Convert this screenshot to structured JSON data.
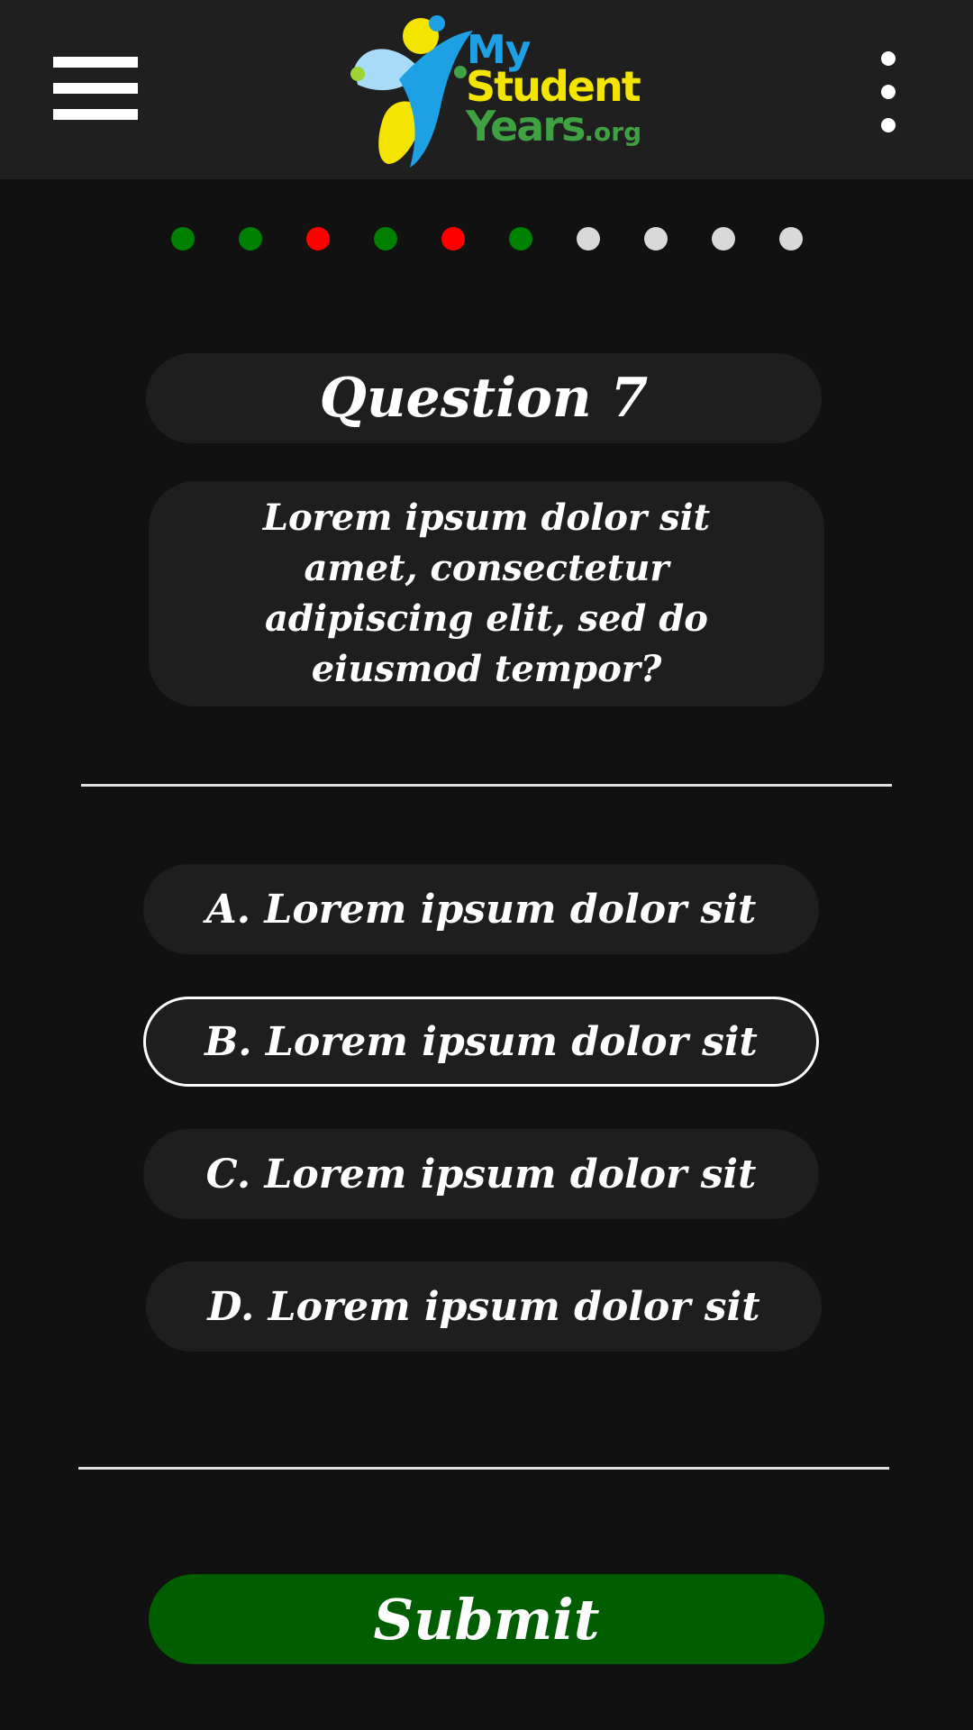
{
  "header": {
    "logo": {
      "line1": "My",
      "line2": "Student",
      "line3_main": "Years",
      "line3_suffix": ".org",
      "colors": {
        "blue": "#1da1e4",
        "yellow": "#f4e500",
        "green": "#3fa142",
        "light_blue": "#a8dbf7"
      }
    },
    "menu_icon": "hamburger-menu-icon",
    "more_icon": "vertical-dots-icon"
  },
  "progress": {
    "states": [
      "correct",
      "correct",
      "wrong",
      "correct",
      "wrong",
      "correct",
      "pending",
      "pending",
      "pending",
      "pending"
    ],
    "colors": {
      "correct": "#008000",
      "wrong": "#ff0000",
      "pending": "#d9d9d9"
    }
  },
  "question": {
    "title": "Question 7",
    "text": "Lorem ipsum dolor sit amet, consectetur adipiscing elit, sed do eiusmod tempor?"
  },
  "options": [
    {
      "label": "A. Lorem ipsum dolor sit",
      "selected": false
    },
    {
      "label": "B. Lorem ipsum dolor sit",
      "selected": true
    },
    {
      "label": "C. Lorem ipsum dolor sit",
      "selected": false
    },
    {
      "label": "D. Lorem ipsum dolor sit",
      "selected": false
    }
  ],
  "submit_label": "Submit",
  "colors": {
    "background": "#111111",
    "header": "#1f1f1f",
    "pill": "#1e1e1e",
    "submit": "#005d00"
  }
}
